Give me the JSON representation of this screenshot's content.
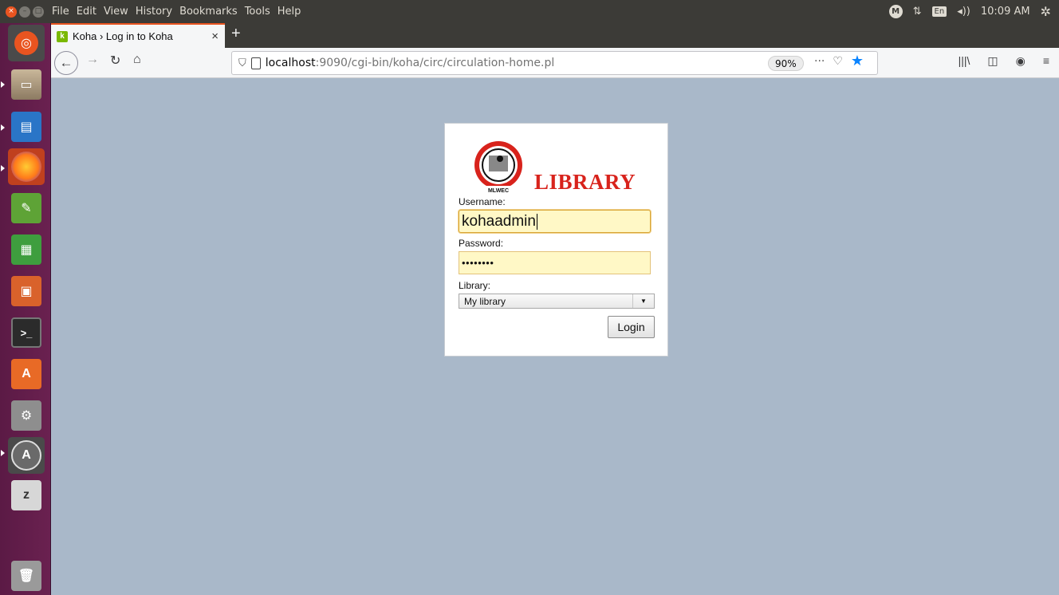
{
  "system": {
    "menu": [
      "File",
      "Edit",
      "View",
      "History",
      "Bookmarks",
      "Tools",
      "Help"
    ],
    "tray": {
      "keyboard": "En",
      "volume": "◂))",
      "clock": "10:09 AM"
    }
  },
  "browser": {
    "tab_title": "Koha › Log in to Koha",
    "url_host": "localhost",
    "url_path": ":9090/cgi-bin/koha/circ/circulation-home.pl",
    "zoom": "90%"
  },
  "login": {
    "logo_text": "LIBRARY",
    "logo_caption": "MLWEC",
    "username_label": "Username:",
    "username_value": "kohaadmin",
    "password_label": "Password:",
    "password_mask": "••••••••",
    "library_label": "Library:",
    "library_selected": "My library",
    "login_button": "Login"
  },
  "launcher": {
    "icons": [
      "ubuntu-dash-icon",
      "files-icon",
      "writer-icon",
      "firefox-icon",
      "notes-icon",
      "calc-icon",
      "impress-icon",
      "terminal-icon",
      "software-icon",
      "settings-icon",
      "updater-icon",
      "backup-icon",
      "trash-icon"
    ]
  }
}
